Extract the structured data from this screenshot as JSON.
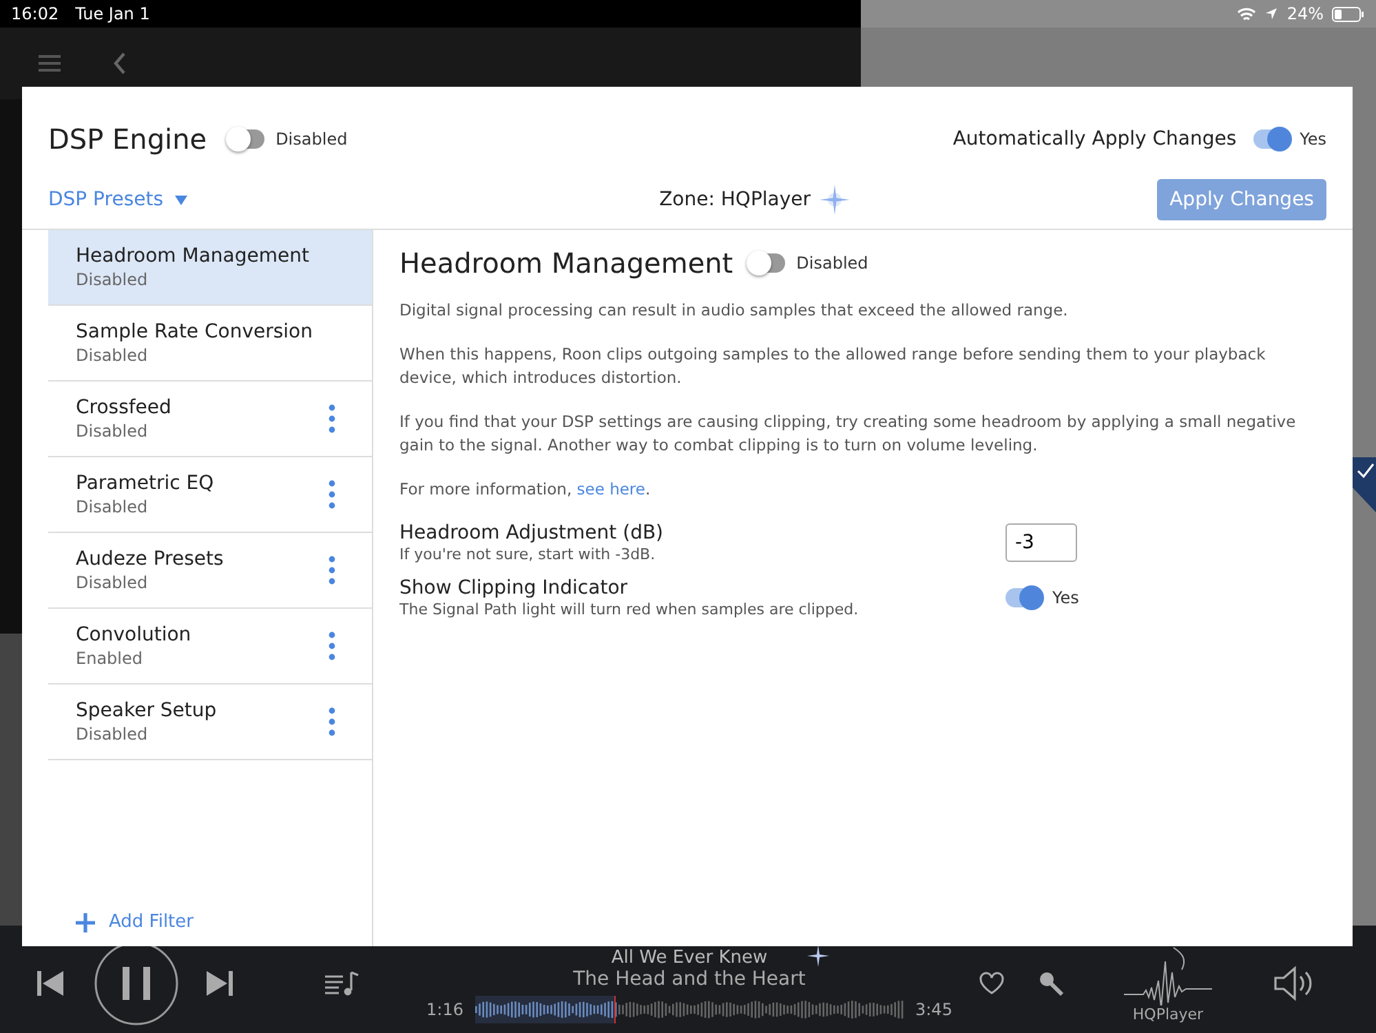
{
  "status_bar": {
    "time": "16:02",
    "date": "Tue Jan 1",
    "battery": "24%"
  },
  "dialog": {
    "title": "DSP Engine",
    "engine_toggle": {
      "on": false,
      "label": "Disabled"
    },
    "auto_apply": {
      "label": "Automatically Apply Changes",
      "on": true,
      "value": "Yes"
    },
    "presets_menu": "DSP Presets",
    "zone": "Zone: HQPlayer",
    "apply_button": {
      "label": "Apply Changes",
      "disabled": true
    },
    "filters": [
      {
        "name": "Headroom Management",
        "status": "Disabled",
        "selected": true,
        "has_menu": false
      },
      {
        "name": "Sample Rate Conversion",
        "status": "Disabled",
        "selected": false,
        "has_menu": false
      },
      {
        "name": "Crossfeed",
        "status": "Disabled",
        "selected": false,
        "has_menu": true
      },
      {
        "name": "Parametric EQ",
        "status": "Disabled",
        "selected": false,
        "has_menu": true
      },
      {
        "name": "Audeze Presets",
        "status": "Disabled",
        "selected": false,
        "has_menu": true
      },
      {
        "name": "Convolution",
        "status": "Enabled",
        "selected": false,
        "has_menu": true
      },
      {
        "name": "Speaker Setup",
        "status": "Disabled",
        "selected": false,
        "has_menu": true
      }
    ],
    "add_filter": "Add Filter",
    "detail": {
      "title": "Headroom Management",
      "toggle": {
        "on": false,
        "label": "Disabled"
      },
      "paragraphs": [
        "Digital signal processing can result in audio samples that exceed the allowed range.",
        "When this happens, Roon clips outgoing samples to the allowed range before sending them to your playback device, which introduces distortion.",
        "If you find that your DSP settings are causing clipping, try creating some headroom by applying a small negative gain to the signal. Another way to combat clipping is to turn on volume leveling."
      ],
      "more_info": {
        "text": "For more information, ",
        "link": "see here",
        "after": "."
      },
      "settings": [
        {
          "kind": "number",
          "label": "Headroom Adjustment (dB)",
          "hint": "If you're not sure, start with -3dB.",
          "value": "-3"
        },
        {
          "kind": "toggle",
          "label": "Show Clipping Indicator",
          "hint": "The Signal Path light will turn red when samples are clipped.",
          "on": true,
          "value": "Yes"
        }
      ]
    }
  },
  "player": {
    "title": "All We Ever Knew",
    "artist": "The Head and the Heart",
    "elapsed": "1:16",
    "duration": "3:45",
    "level": 0.33,
    "zone": "HQPlayer"
  }
}
